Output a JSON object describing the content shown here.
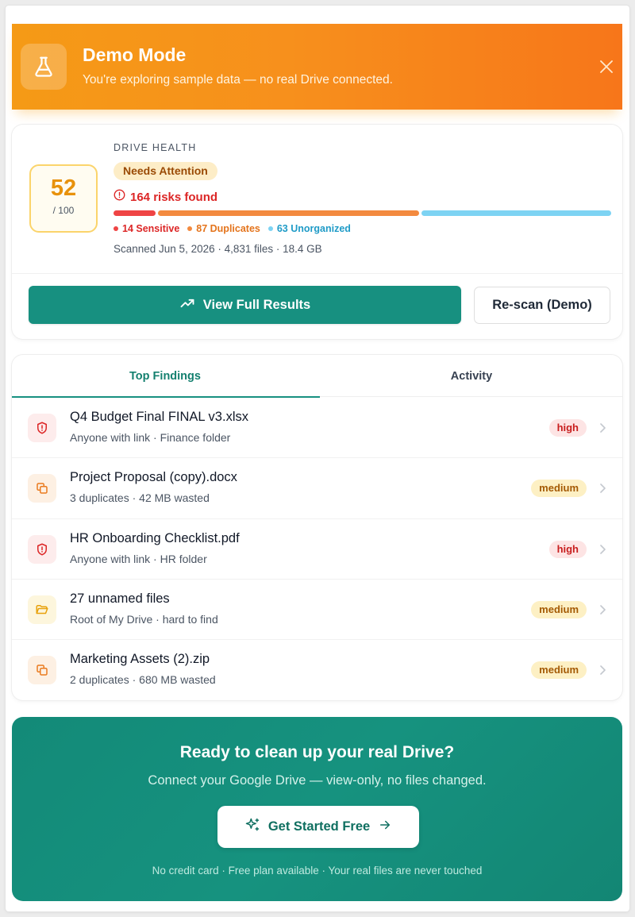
{
  "banner": {
    "title": "Demo Mode",
    "subtitle": "You're exploring sample data — no real Drive connected.",
    "icon": "flask-icon",
    "close_icon": "close-icon",
    "colors": {
      "gradient_start": "#f59a16",
      "gradient_end": "#f7761a"
    }
  },
  "health": {
    "label": "DRIVE HEALTH",
    "score": "52",
    "score_max": "/ 100",
    "status": "Needs Attention",
    "risks_text": "164 risks found",
    "risk_total": 164,
    "breakdown": [
      {
        "label": "14 Sensitive",
        "count": 14,
        "color": "#ef4444",
        "text_color": "#dc2626"
      },
      {
        "label": "87 Duplicates",
        "count": 87,
        "color": "#f38a3f",
        "text_color": "#e4741c"
      },
      {
        "label": "63 Unorganized",
        "count": 63,
        "color": "#7dd3f3",
        "text_color": "#1f9bc7"
      }
    ],
    "scanned": "Scanned Jun 5, 2026 · 4,831 files · 18.4 GB",
    "view_button": "View Full Results",
    "rescan_button": "Re-scan (Demo)"
  },
  "tabs": [
    {
      "label": "Top Findings",
      "active": true
    },
    {
      "label": "Activity",
      "active": false
    }
  ],
  "findings": [
    {
      "title": "Q4 Budget Final FINAL v3.xlsx",
      "subtitle": "Anyone with link · Finance folder",
      "severity": "high",
      "icon": "shield-alert-icon"
    },
    {
      "title": "Project Proposal (copy).docx",
      "subtitle": "3 duplicates · 42 MB wasted",
      "severity": "medium",
      "icon": "copy-icon"
    },
    {
      "title": "HR Onboarding Checklist.pdf",
      "subtitle": "Anyone with link · HR folder",
      "severity": "high",
      "icon": "shield-alert-icon"
    },
    {
      "title": "27 unnamed files",
      "subtitle": "Root of My Drive · hard to find",
      "severity": "medium",
      "icon": "folder-open-icon"
    },
    {
      "title": "Marketing Assets (2).zip",
      "subtitle": "2 duplicates · 680 MB wasted",
      "severity": "medium",
      "icon": "copy-icon"
    }
  ],
  "cta": {
    "title": "Ready to clean up your real Drive?",
    "subtitle": "Connect your Google Drive — view-only, no files changed.",
    "button": "Get Started Free",
    "note": "No credit card · Free plan available · Your real files are never touched"
  },
  "colors": {
    "accent": "#179080",
    "high": "#c81e1e",
    "medium": "#a45a04"
  }
}
